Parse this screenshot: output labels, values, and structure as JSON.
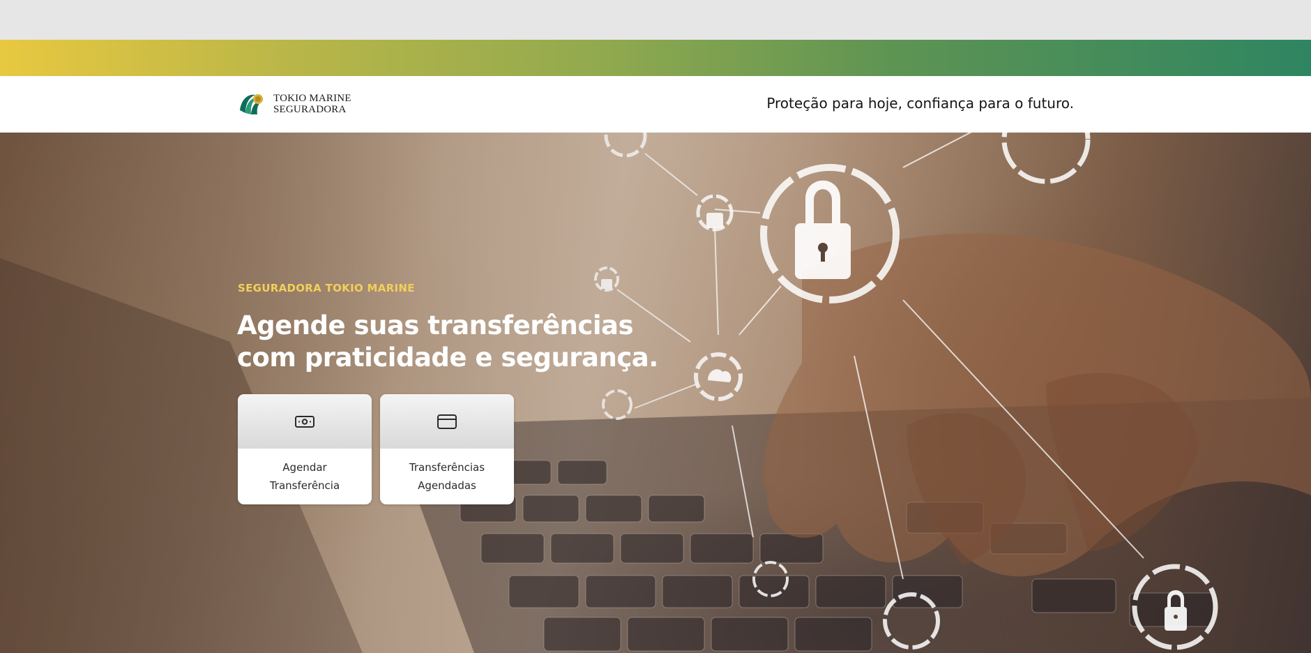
{
  "header": {
    "logo_line1": "TOKIO MARINE",
    "logo_line2": "SEGURADORA",
    "tagline": "Proteção para hoje, confiança para o futuro."
  },
  "hero": {
    "eyebrow": "SEGURADORA TOKIO MARINE",
    "headline": "Agende suas transferências com praticidade e segurança.",
    "cards": [
      {
        "label": "Agendar Transferência",
        "icon": "cash-icon"
      },
      {
        "label": "Transferências Agendadas",
        "icon": "credit-card-icon"
      }
    ]
  },
  "colors": {
    "gradient_start": "#e8c840",
    "gradient_end": "#2e8561",
    "eyebrow": "#f3cf5a",
    "headline": "#ffffff"
  }
}
